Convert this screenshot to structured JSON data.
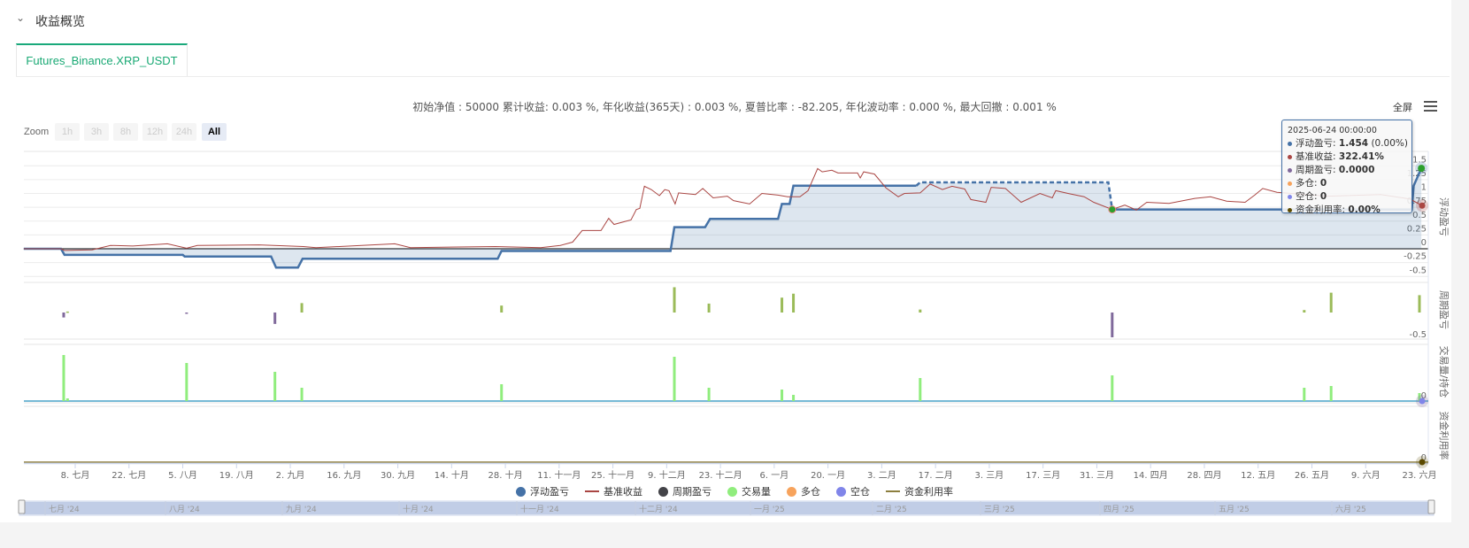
{
  "header": {
    "section_title": "收益概览",
    "collapse_icon": "chevron-down-icon"
  },
  "tabs": [
    {
      "label": "Futures_Binance.XRP_USDT",
      "active": true
    }
  ],
  "stats_line": "初始净值 : 50000 累计收益: 0.003 %, 年化收益(365天) : 0.003 %, 夏普比率 : -82.205, 年化波动率 : 0.000 %, 最大回撤 : 0.001 %",
  "toolbar": {
    "fullscreen_label": "全屏",
    "menu_icon": "hamburger-menu-icon"
  },
  "zoom": {
    "label": "Zoom",
    "buttons": [
      "1h",
      "3h",
      "8h",
      "12h",
      "24h",
      "All"
    ],
    "active": "All"
  },
  "tooltip": {
    "date": "2025-06-24 00:00:00",
    "rows": [
      {
        "label": "浮动盈亏: ",
        "value": "1.454",
        "suffix": " (0.00%)",
        "color": "#4572a7"
      },
      {
        "label": "基准收益: ",
        "value": "322.41%",
        "suffix": "",
        "color": "#aa4643"
      },
      {
        "label": "周期盈亏: ",
        "value": "0.0000",
        "suffix": "",
        "color": "#80699b"
      },
      {
        "label": "多仓: ",
        "value": "0",
        "suffix": "",
        "color": "#f7a35c"
      },
      {
        "label": "空仓: ",
        "value": "0",
        "suffix": "",
        "color": "#8085e9"
      },
      {
        "label": "资金利用率: ",
        "value": "0.00%",
        "suffix": "",
        "color": "#5c4a00"
      }
    ]
  },
  "legend": [
    {
      "label": "浮动盈亏",
      "shape": "circle",
      "color": "#4572a7"
    },
    {
      "label": "基准收益",
      "shape": "line",
      "color": "#aa4643"
    },
    {
      "label": "周期盈亏",
      "shape": "circle",
      "color": "#434348"
    },
    {
      "label": "交易量",
      "shape": "circle",
      "color": "#90ed7d"
    },
    {
      "label": "多仓",
      "shape": "circle",
      "color": "#f7a35c"
    },
    {
      "label": "空仓",
      "shape": "circle",
      "color": "#8085e9"
    },
    {
      "label": "资金利用率",
      "shape": "line",
      "color": "#8d7f3f"
    }
  ],
  "chart_data": {
    "type": "line",
    "x_unit": "days since 2024-07-08",
    "x_range": [
      -13.4,
      351
    ],
    "x_tick_labels": [
      "8. 七月",
      "22. 七月",
      "5. 八月",
      "19. 八月",
      "2. 九月",
      "16. 九月",
      "30. 九月",
      "14. 十月",
      "28. 十月",
      "11. 十一月",
      "25. 十一月",
      "9. 十二月",
      "23. 十二月",
      "6. 一月",
      "20. 一月",
      "3. 二月",
      "17. 二月",
      "3. 三月",
      "17. 三月",
      "31. 三月",
      "14. 四月",
      "28. 四月",
      "12. 五月",
      "26. 五月",
      "9. 六月",
      "23. 六月"
    ],
    "navigator_labels": [
      "七月 '24",
      "八月 '24",
      "九月 '24",
      "十月 '24",
      "十一月 '24",
      "十二月 '24",
      "一月 '25",
      "二月 '25",
      "三月 '25",
      "四月 '25",
      "五月 '25",
      "六月 '25"
    ],
    "panes": [
      {
        "title": "浮动盈亏",
        "ylim": [
          -0.5,
          1.5
        ],
        "tick_labels": [
          "-0.5",
          "-0.25",
          "0",
          "0.25",
          "0.5",
          "0.75",
          "1",
          "1.25",
          "1.5"
        ],
        "tick_values": [
          -0.5,
          -0.25,
          0,
          0.25,
          0.5,
          0.75,
          1,
          1.25,
          1.5
        ]
      },
      {
        "title": "周期盈亏",
        "tick_labels": [
          "-0.5"
        ]
      },
      {
        "title": "交易量/持仓",
        "tick_labels": [
          "0"
        ]
      },
      {
        "title": "资金利用率",
        "tick_labels": [
          "0"
        ]
      }
    ],
    "series": [
      {
        "name": "浮动盈亏",
        "color": "#4572a7",
        "dashed_range": [
          219,
          270
        ],
        "points": [
          [
            -13.4,
            0
          ],
          [
            -3.7,
            0
          ],
          [
            -2.8,
            -0.11
          ],
          [
            28,
            -0.11
          ],
          [
            28.5,
            -0.14
          ],
          [
            51,
            -0.14
          ],
          [
            52.3,
            -0.34
          ],
          [
            58,
            -0.34
          ],
          [
            59.2,
            -0.18
          ],
          [
            110,
            -0.18
          ],
          [
            111,
            -0.04
          ],
          [
            155,
            -0.04
          ],
          [
            156,
            0.39
          ],
          [
            164,
            0.39
          ],
          [
            165.3,
            0.54
          ],
          [
            183,
            0.54
          ],
          [
            184,
            0.81
          ],
          [
            186,
            0.81
          ],
          [
            187,
            1.14
          ],
          [
            219,
            1.14
          ],
          [
            220,
            1.2
          ],
          [
            269,
            1.2
          ],
          [
            270,
            0.71
          ],
          [
            348,
            0.71
          ],
          [
            348.5,
            1.14
          ],
          [
            350.5,
            1.454
          ]
        ]
      },
      {
        "name": "基准收益",
        "color": "#aa4643",
        "points": [
          [
            -13.4,
            0
          ],
          [
            -3.7,
            0
          ],
          [
            -2.8,
            -0.03
          ],
          [
            4.4,
            -0.02
          ],
          [
            9.2,
            0.06
          ],
          [
            15,
            0.05
          ],
          [
            24,
            0.09
          ],
          [
            29,
            0.01
          ],
          [
            31.8,
            0.06
          ],
          [
            47.9,
            0.07
          ],
          [
            59.4,
            0.04
          ],
          [
            62.7,
            0.02
          ],
          [
            83.2,
            0.09
          ],
          [
            87.3,
            0.02
          ],
          [
            109.4,
            0.04
          ],
          [
            121.2,
            0.02
          ],
          [
            126.3,
            0.06
          ],
          [
            129.5,
            0.12
          ],
          [
            132,
            0.33
          ],
          [
            136.9,
            0.33
          ],
          [
            138.9,
            0.55
          ],
          [
            140.3,
            0.44
          ],
          [
            143.5,
            0.5
          ],
          [
            144.7,
            0.52
          ],
          [
            146.1,
            0.71
          ],
          [
            147,
            0.73
          ],
          [
            148.2,
            1.13
          ],
          [
            150,
            1.07
          ],
          [
            152.1,
            0.96
          ],
          [
            153.5,
            1.07
          ],
          [
            154.6,
            1.05
          ],
          [
            156.2,
            0.81
          ],
          [
            157.1,
            1.01
          ],
          [
            161.5,
            0.98
          ],
          [
            163.4,
            1.09
          ],
          [
            166.1,
            0.92
          ],
          [
            169.8,
            0.95
          ],
          [
            171.4,
            0.87
          ],
          [
            175.6,
            0.81
          ],
          [
            178.8,
            1.0
          ],
          [
            183,
            0.97
          ],
          [
            185.5,
            0.94
          ],
          [
            188.7,
            0.94
          ],
          [
            190.8,
            1.05
          ],
          [
            193.3,
            1.45
          ],
          [
            194.5,
            1.39
          ],
          [
            197,
            1.42
          ],
          [
            198.6,
            1.37
          ],
          [
            203.7,
            1.37
          ],
          [
            204.4,
            1.28
          ],
          [
            205.3,
            1.39
          ],
          [
            208.1,
            1.35
          ],
          [
            211.1,
            1.1
          ],
          [
            214.3,
            0.94
          ],
          [
            215.9,
            1.0
          ],
          [
            220,
            1.01
          ],
          [
            222.6,
            1.17
          ],
          [
            225.8,
            1.07
          ],
          [
            228.3,
            1.13
          ],
          [
            231.6,
            1.08
          ],
          [
            233.2,
            0.89
          ],
          [
            237.1,
            0.84
          ],
          [
            238.5,
            1.11
          ],
          [
            242.2,
            1.09
          ],
          [
            246.3,
            0.84
          ],
          [
            251.2,
            1.0
          ],
          [
            254.4,
            0.92
          ],
          [
            255.3,
            1.05
          ],
          [
            258.5,
            1.0
          ],
          [
            262.7,
            0.94
          ],
          [
            265.2,
            0.84
          ],
          [
            270,
            0.71
          ],
          [
            273.3,
            0.79
          ],
          [
            276.3,
            0.7
          ],
          [
            279,
            0.84
          ],
          [
            284.8,
            0.82
          ],
          [
            291.5,
            0.91
          ],
          [
            295.6,
            0.94
          ],
          [
            299.8,
            0.86
          ],
          [
            304.6,
            0.84
          ],
          [
            307.1,
            0.97
          ],
          [
            309.2,
            1.09
          ],
          [
            312.9,
            1.02
          ],
          [
            326,
            0.95
          ],
          [
            339.9,
            0.98
          ],
          [
            347.5,
            0.9
          ],
          [
            350.7,
            0.78
          ]
        ]
      },
      {
        "name": "周期盈亏",
        "type": "bar",
        "color_pos": "#9bbb59",
        "color_neg": "#80699b",
        "points": [
          [
            -3,
            -0.1
          ],
          [
            -2,
            0.02
          ],
          [
            29,
            -0.01
          ],
          [
            52,
            -0.23
          ],
          [
            59,
            0.19
          ],
          [
            111,
            0.14
          ],
          [
            156,
            0.51
          ],
          [
            165,
            0.18
          ],
          [
            184,
            0.3
          ],
          [
            187,
            0.38
          ],
          [
            220,
            0.06
          ],
          [
            270,
            -0.5
          ],
          [
            320,
            0.05
          ],
          [
            327,
            0.4
          ],
          [
            350,
            0.35
          ]
        ]
      },
      {
        "name": "交易量",
        "type": "bar",
        "color": "#90ed7d",
        "ylim": [
          0,
          64
        ],
        "points": [
          [
            -3,
            52
          ],
          [
            -2,
            3
          ],
          [
            29,
            43
          ],
          [
            52,
            33
          ],
          [
            59,
            15
          ],
          [
            111,
            19
          ],
          [
            156,
            50
          ],
          [
            165,
            15
          ],
          [
            184,
            13
          ],
          [
            187,
            7
          ],
          [
            220,
            26
          ],
          [
            270,
            29
          ],
          [
            320,
            15
          ],
          [
            327,
            17
          ],
          [
            350,
            9
          ]
        ]
      },
      {
        "name": "资金利用率",
        "color": "#8d7f3f",
        "points": [
          [
            -13.4,
            0
          ],
          [
            351,
            0
          ]
        ]
      }
    ]
  }
}
